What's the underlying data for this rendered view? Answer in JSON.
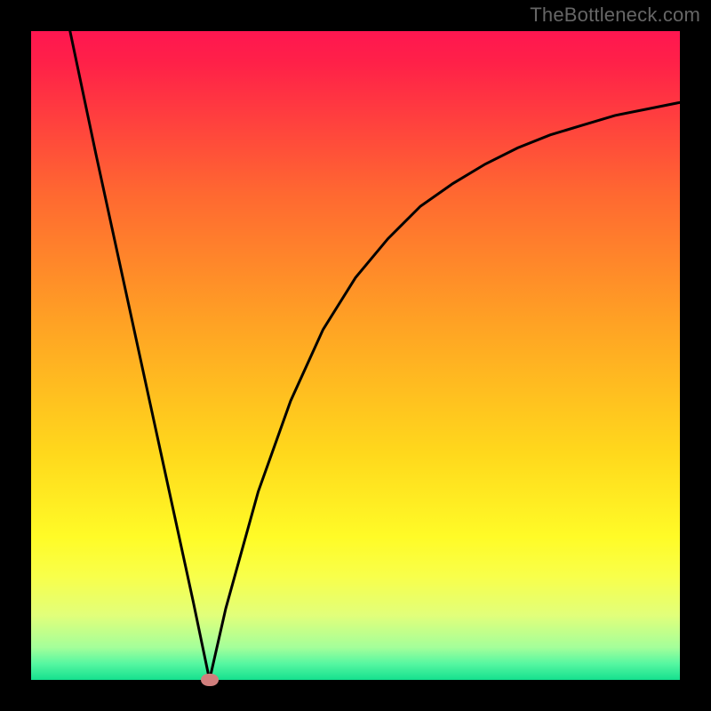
{
  "watermark": "TheBottleneck.com",
  "chart_data": {
    "type": "line",
    "title": "",
    "xlabel": "",
    "ylabel": "",
    "xlim": [
      0,
      100
    ],
    "ylim": [
      0,
      100
    ],
    "grid": false,
    "series": [
      {
        "name": "left-branch",
        "x": [
          6,
          10,
          15,
          20,
          25,
          27.5
        ],
        "values": [
          100,
          81,
          58,
          35,
          12,
          0
        ]
      },
      {
        "name": "right-branch",
        "x": [
          27.5,
          30,
          35,
          40,
          45,
          50,
          55,
          60,
          65,
          70,
          75,
          80,
          85,
          90,
          95,
          100
        ],
        "values": [
          0,
          11,
          29,
          43,
          54,
          62,
          68,
          73,
          76.5,
          79.5,
          82,
          84,
          85.5,
          87,
          88,
          89
        ]
      }
    ],
    "marker": {
      "x": 27.5,
      "y": 0,
      "color": "#d17f7d"
    },
    "gradient_stops": [
      {
        "offset": 0.0,
        "color": "#ff1650"
      },
      {
        "offset": 0.05,
        "color": "#ff2148"
      },
      {
        "offset": 0.25,
        "color": "#ff6831"
      },
      {
        "offset": 0.45,
        "color": "#ffa224"
      },
      {
        "offset": 0.65,
        "color": "#ffd81c"
      },
      {
        "offset": 0.78,
        "color": "#fffb27"
      },
      {
        "offset": 0.84,
        "color": "#f8ff4a"
      },
      {
        "offset": 0.9,
        "color": "#e2ff7a"
      },
      {
        "offset": 0.95,
        "color": "#a4ff9a"
      },
      {
        "offset": 0.975,
        "color": "#56f7a1"
      },
      {
        "offset": 1.0,
        "color": "#15e08f"
      }
    ],
    "line_color": "#000000",
    "line_width": 3
  }
}
